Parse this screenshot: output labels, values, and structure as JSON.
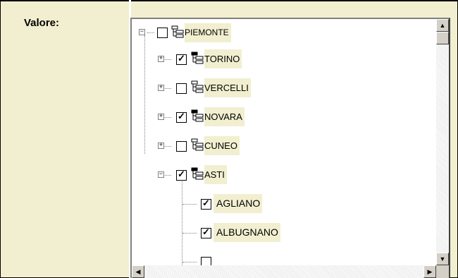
{
  "field": {
    "label": "Valore:"
  },
  "tree": {
    "nodes": [
      {
        "label": "PIEMONTE",
        "checked": false,
        "expander": "−",
        "icon": "hierarchy-icon"
      },
      {
        "label": "TORINO",
        "checked": true,
        "expander": "+",
        "icon": "hierarchy-icon"
      },
      {
        "label": "VERCELLI",
        "checked": false,
        "expander": "+",
        "icon": "hierarchy-icon"
      },
      {
        "label": "NOVARA",
        "checked": true,
        "expander": "+",
        "icon": "hierarchy-icon"
      },
      {
        "label": "CUNEO",
        "checked": false,
        "expander": "+",
        "icon": "hierarchy-icon"
      },
      {
        "label": "ASTI",
        "checked": true,
        "expander": "−",
        "icon": "hierarchy-icon"
      },
      {
        "label": "AGLIANO",
        "checked": true,
        "icon": "none"
      },
      {
        "label": "ALBUGNANO",
        "checked": true,
        "icon": "none"
      }
    ]
  },
  "colors": {
    "panel_bg": "#f1efcf",
    "tree_bg": "#ffffff",
    "scrollbar_face": "#d4d0c8"
  }
}
